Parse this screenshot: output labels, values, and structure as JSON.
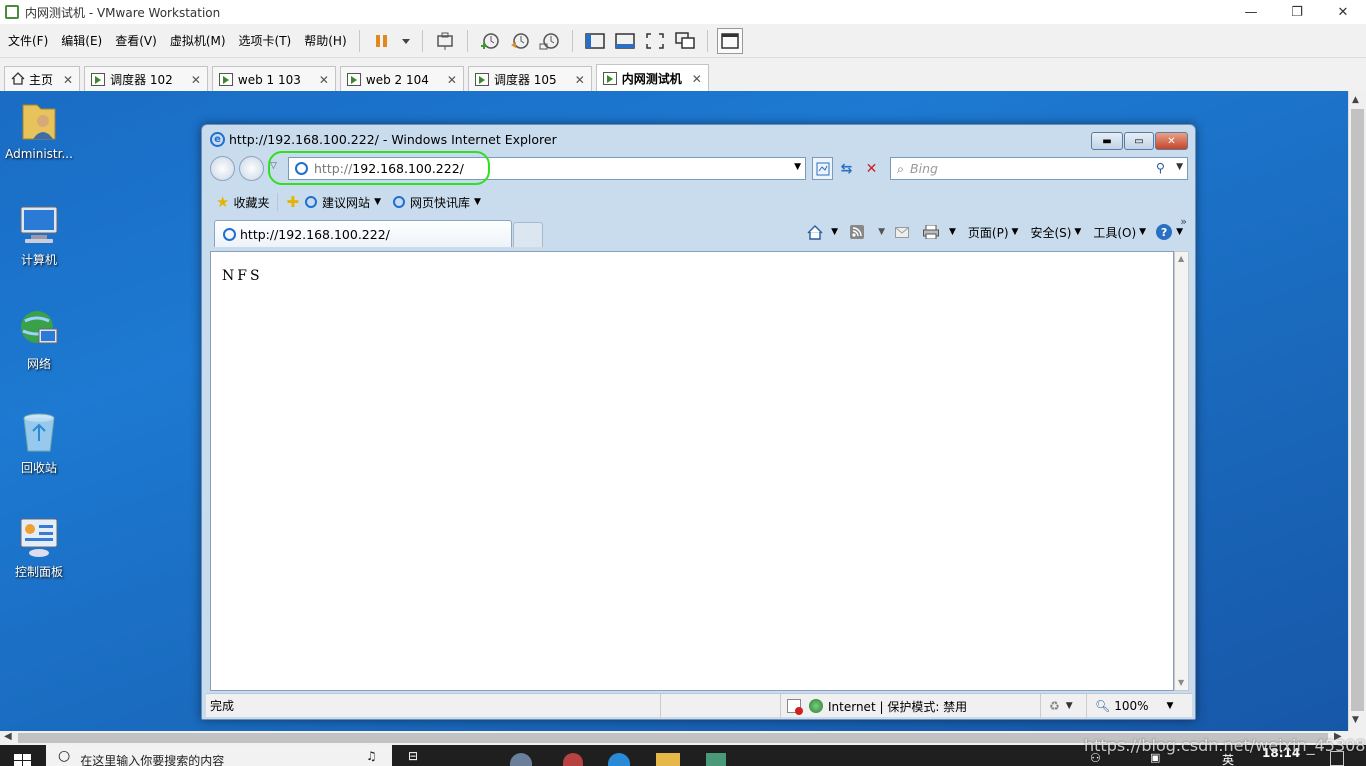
{
  "vmware": {
    "window_title": "内网测试机 - VMware Workstation",
    "menu": [
      "文件(F)",
      "编辑(E)",
      "查看(V)",
      "虚拟机(M)",
      "选项卡(T)",
      "帮助(H)"
    ],
    "window_controls": {
      "minimize": "—",
      "restore": "❐",
      "close": "✕"
    },
    "tabs": [
      {
        "label": "主页",
        "active": false
      },
      {
        "label": "调度器 102",
        "active": false
      },
      {
        "label": "web 1 103",
        "active": false
      },
      {
        "label": "web 2 104",
        "active": false
      },
      {
        "label": "调度器 105",
        "active": false
      },
      {
        "label": "内网测试机",
        "active": true
      }
    ],
    "tab_close": "✕"
  },
  "desktop": {
    "icons": [
      {
        "label": "Administr...",
        "icon": "user-folder-icon"
      },
      {
        "label": "计算机",
        "icon": "computer-icon"
      },
      {
        "label": "网络",
        "icon": "network-icon"
      },
      {
        "label": "回收站",
        "icon": "recycle-bin-icon"
      },
      {
        "label": "控制面板",
        "icon": "control-panel-icon"
      }
    ]
  },
  "ie": {
    "title": "http://192.168.100.222/ - Windows Internet Explorer",
    "address_prefix": "http://",
    "address_host": "192.168.100.222/",
    "search_placeholder": "Bing",
    "favorites_label": "收藏夹",
    "suggested_sites": "建议网站",
    "web_slice_gallery": "网页快讯库",
    "tab_label": "http://192.168.100.222/",
    "commands": {
      "page": "页面(P)",
      "safety": "安全(S)",
      "tools": "工具(O)"
    },
    "page_body_text": "NFS",
    "status_text": "完成",
    "zone_text": "Internet | 保护模式: 禁用",
    "zoom": "100%"
  },
  "host": {
    "search_text": "在这里输入你要搜索的内容",
    "time": "18:14",
    "watermark": "https://blog.csdn.net/weixin_45308292",
    "ime": "英"
  },
  "colors": {
    "annotation_ring": "#30e020",
    "desktop": "#1a6cc4"
  }
}
